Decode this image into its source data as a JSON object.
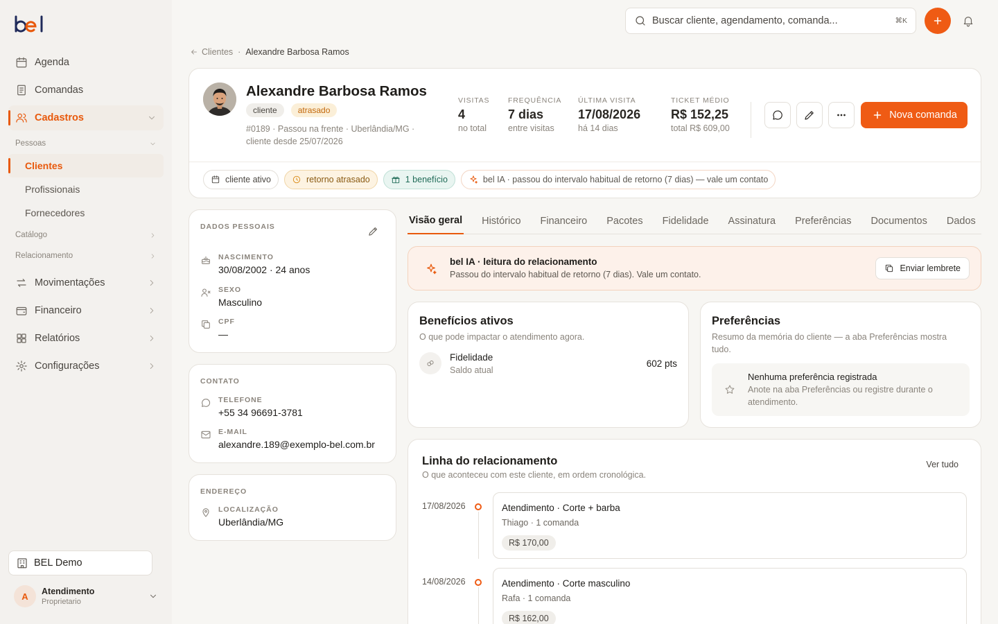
{
  "brand": {
    "logo_text": "bel",
    "accent": "#ef5b14"
  },
  "sidebar": {
    "items": [
      {
        "label": "Agenda",
        "icon": "calendar-icon"
      },
      {
        "label": "Comandas",
        "icon": "receipt-icon"
      },
      {
        "label": "Cadastros",
        "icon": "users-icon",
        "active": true
      }
    ],
    "group_pessoas": "Pessoas",
    "sub_items": [
      "Clientes",
      "Profissionais",
      "Fornecedores"
    ],
    "group_catalogo": "Catálogo",
    "group_relacionamento": "Relacionamento",
    "items_bottom": [
      {
        "label": "Movimentações",
        "icon": "arrows-icon"
      },
      {
        "label": "Financeiro",
        "icon": "wallet-icon"
      },
      {
        "label": "Relatórios",
        "icon": "grid-icon"
      },
      {
        "label": "Configurações",
        "icon": "gear-icon"
      }
    ],
    "workspace": "BEL Demo",
    "user": {
      "initial": "A",
      "name": "Atendimento",
      "role": "Proprietario"
    }
  },
  "topbar": {
    "search_placeholder": "Buscar cliente, agendamento, comanda...",
    "shortcut": "⌘K"
  },
  "breadcrumb": {
    "back": "Clientes",
    "sep": "·",
    "current": "Alexandre Barbosa Ramos"
  },
  "profile": {
    "name": "Alexandre Barbosa Ramos",
    "badges": [
      "cliente",
      "atrasado"
    ],
    "meta": "#0189 · Passou na frente · Uberlândia/MG · cliente desde 25/07/2026",
    "stats": [
      {
        "key": "VISITAS",
        "value": "4",
        "sub": "no total"
      },
      {
        "key": "FREQUÊNCIA",
        "value": "7 dias",
        "sub": "entre visitas"
      },
      {
        "key": "ÚLTIMA VISITA",
        "value": "17/08/2026",
        "sub": "há 14 dias"
      },
      {
        "key": "TICKET MÉDIO",
        "value": "R$ 152,25",
        "sub": "total R$ 609,00"
      }
    ],
    "cta": "Nova comanda",
    "chips": [
      "cliente ativo",
      "retorno atrasado",
      "1 benefício",
      "bel IA · passou do intervalo habitual de retorno (7 dias) — vale um contato"
    ]
  },
  "personal": {
    "title": "DADOS PESSOAIS",
    "fields": [
      {
        "key": "NASCIMENTO",
        "value": "30/08/2002 · 24 anos"
      },
      {
        "key": "SEXO",
        "value": "Masculino"
      },
      {
        "key": "CPF",
        "value": "—"
      }
    ]
  },
  "contact": {
    "title": "CONTATO",
    "fields": [
      {
        "key": "TELEFONE",
        "value": "+55 34 96691-3781"
      },
      {
        "key": "E-MAIL",
        "value": "alexandre.189@exemplo-bel.com.br"
      }
    ]
  },
  "address": {
    "title": "ENDEREÇO",
    "fields": [
      {
        "key": "LOCALIZAÇÃO",
        "value": "Uberlândia/MG"
      }
    ]
  },
  "tabs": [
    "Visão geral",
    "Histórico",
    "Financeiro",
    "Pacotes",
    "Fidelidade",
    "Assinatura",
    "Preferências",
    "Documentos",
    "Dados"
  ],
  "ai": {
    "title": "bel IA · leitura do relacionamento",
    "text": "Passou do intervalo habitual de retorno (7 dias). Vale um contato.",
    "button": "Enviar lembrete"
  },
  "benefits": {
    "title": "Benefícios ativos",
    "sub": "O que pode impactar o atendimento agora.",
    "item": {
      "name": "Fidelidade",
      "desc": "Saldo atual",
      "value": "602 pts"
    }
  },
  "preferences": {
    "title": "Preferências",
    "sub": "Resumo da memória do cliente — a aba Preferências mostra tudo.",
    "empty_title": "Nenhuma preferência registrada",
    "empty_text": "Anote na aba Preferências ou registre durante o atendimento."
  },
  "timeline": {
    "title": "Linha do relacionamento",
    "sub": "O que aconteceu com este cliente, em ordem cronológica.",
    "link": "Ver tudo",
    "entries": [
      {
        "date": "17/08/2026",
        "title": "Atendimento · Corte + barba",
        "sub": "Thiago · 1 comanda",
        "amount": "R$ 170,00"
      },
      {
        "date": "14/08/2026",
        "title": "Atendimento · Corte masculino",
        "sub": "Rafa · 1 comanda",
        "amount": "R$ 162,00"
      }
    ]
  }
}
